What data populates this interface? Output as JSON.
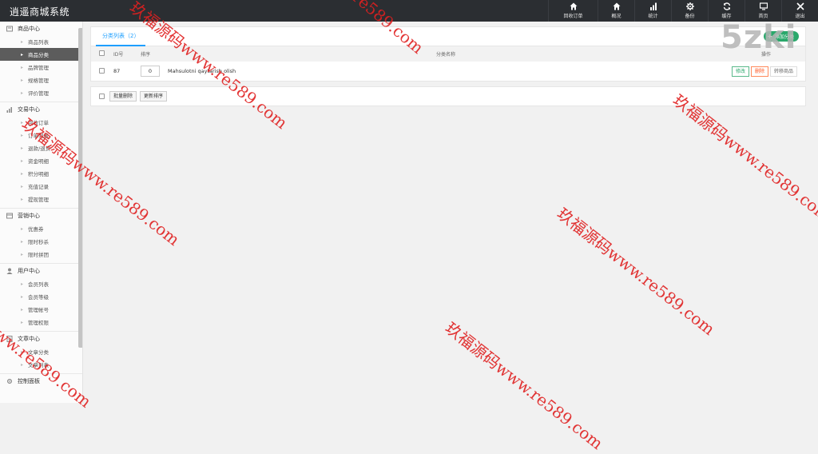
{
  "app": {
    "title": "逍遥商城系统"
  },
  "topnav": [
    {
      "label": "回收订单",
      "icon": "home-icon"
    },
    {
      "label": "概况",
      "icon": "home-icon"
    },
    {
      "label": "统计",
      "icon": "bar-chart-icon"
    },
    {
      "label": "备份",
      "icon": "gear-icon"
    },
    {
      "label": "缓存",
      "icon": "refresh-icon"
    },
    {
      "label": "首页",
      "icon": "monitor-icon"
    },
    {
      "label": "退出",
      "icon": "close-icon"
    }
  ],
  "sidebar": {
    "groups": [
      {
        "label": "商品中心",
        "icon": "product-icon",
        "items": [
          "商品列表",
          "商品分类",
          "品牌管理",
          "规格管理",
          "评价管理"
        ],
        "active": 1
      },
      {
        "label": "交易中心",
        "icon": "chart-icon",
        "items": [
          "回收订单",
          "订单列表",
          "退款/退货",
          "资金明细",
          "积分明细",
          "充值记录",
          "提现管理"
        ]
      },
      {
        "label": "营销中心",
        "icon": "marketing-icon",
        "items": [
          "优惠券",
          "限时秒杀",
          "限时拼团"
        ]
      },
      {
        "label": "用户中心",
        "icon": "user-icon",
        "items": [
          "会员列表",
          "会员等级",
          "管理帐号",
          "管理权限"
        ]
      },
      {
        "label": "文章中心",
        "icon": "article-icon",
        "items": [
          "文章分类",
          "文章列表"
        ]
      },
      {
        "label": "控制面板",
        "icon": "gear-icon",
        "items": []
      }
    ]
  },
  "main": {
    "tab_label": "分类列表（2）",
    "add_label": "添加分类",
    "columns": {
      "id": "ID号",
      "order": "排序",
      "name": "分类名称",
      "ops": "操作"
    },
    "rows": [
      {
        "id": "87",
        "order": "0",
        "name": "Mahsulotni qaytarish olish",
        "edit": "修改",
        "del": "删除",
        "move": "转移商品"
      }
    ],
    "bulk_delete": "批量删除",
    "update_order": "更新排序"
  },
  "logo": "5zki",
  "watermark": {
    "cn": "玖福源码",
    "url": "www.re589.com",
    "url_short": "re589.com"
  },
  "colors": {
    "topbar": "#2b2e32",
    "accent": "#1e9fff",
    "green": "#2aa86b",
    "danger": "#ff5722",
    "watermark": "#e02020"
  }
}
